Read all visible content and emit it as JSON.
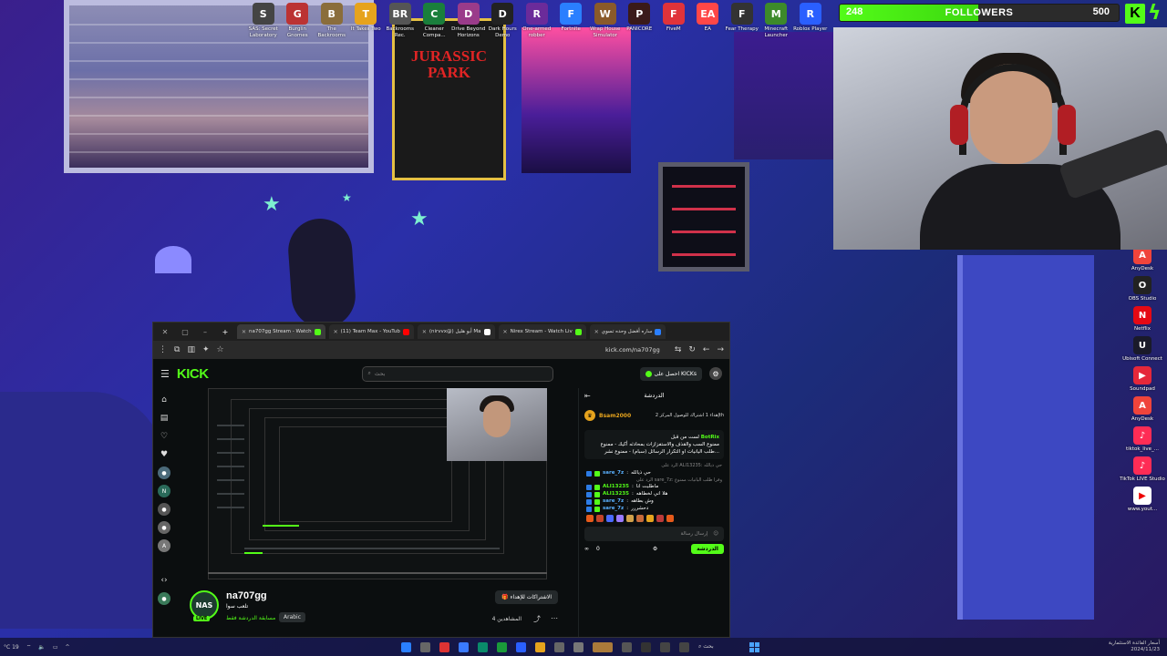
{
  "desktop_top_icons": [
    {
      "label": "SAS: Secret Laboratory",
      "icon": "sas-icon",
      "color": "#444",
      "glyph": "S"
    },
    {
      "label": "Burglin Gnomes",
      "icon": "gnome-icon",
      "color": "#b33",
      "glyph": "G"
    },
    {
      "label": "The Backrooms",
      "icon": "backrooms-icon",
      "color": "#8a6d3b",
      "glyph": "B"
    },
    {
      "label": "It Takes Two",
      "icon": "ittakestwo-icon",
      "color": "#e6a31d",
      "glyph": "T"
    },
    {
      "label": "Backrooms Rec.",
      "icon": "backrooms-rec-icon",
      "color": "#555",
      "glyph": "BR"
    },
    {
      "label": "Cleaner Compa...",
      "icon": "cleaner-icon",
      "color": "#1a7f3c",
      "glyph": "C"
    },
    {
      "label": "Drive Beyond Horizons",
      "icon": "drive-icon",
      "color": "#9a3b8a",
      "glyph": "D"
    },
    {
      "label": "Dark Hours Demo",
      "icon": "darkhours-icon",
      "color": "#222",
      "glyph": "D"
    },
    {
      "label": "One-armed robber",
      "icon": "robber-icon",
      "color": "#6b2b9a",
      "glyph": "R"
    },
    {
      "label": "Fortnite",
      "icon": "fortnite-icon",
      "color": "#2a7fff",
      "glyph": "F"
    },
    {
      "label": "Wrap House Simulator",
      "icon": "wrap-icon",
      "color": "#8a5a2a",
      "glyph": "W"
    },
    {
      "label": "PANICORE",
      "icon": "panicore-icon",
      "color": "#3a1a1a",
      "glyph": "P"
    },
    {
      "label": "FiveM",
      "icon": "fivem-icon",
      "color": "#e0333a",
      "glyph": "F"
    },
    {
      "label": "EA",
      "icon": "ea-icon",
      "color": "#ff4747",
      "glyph": "EA"
    },
    {
      "label": "Fear Therapy",
      "icon": "fear-icon",
      "color": "#333",
      "glyph": "F"
    },
    {
      "label": "Minecraft Launcher",
      "icon": "minecraft-icon",
      "color": "#3d8a2a",
      "glyph": "M"
    },
    {
      "label": "Roblox Player",
      "icon": "roblox-icon",
      "color": "#2a5fff",
      "glyph": "R"
    }
  ],
  "desktop_side_icons": [
    {
      "label": "AnyDesk",
      "icon": "anydesk-icon",
      "color": "#ef443b",
      "glyph": "A"
    },
    {
      "label": "OBS Studio",
      "icon": "obs-icon",
      "color": "#222",
      "glyph": "O"
    },
    {
      "label": "Netflix",
      "icon": "netflix-icon",
      "color": "#e50914",
      "glyph": "N"
    },
    {
      "label": "Ubisoft Connect",
      "icon": "ubisoft-icon",
      "color": "#1a1a2a",
      "glyph": "U"
    },
    {
      "label": "Soundpad",
      "icon": "soundpad-icon",
      "color": "#e5283a",
      "glyph": "▶"
    },
    {
      "label": "AnyDesk",
      "icon": "anydesk-icon",
      "color": "#ef443b",
      "glyph": "A"
    },
    {
      "label": "tiktok_live_...",
      "icon": "tiktok-icon",
      "color": "#fe2c55",
      "glyph": "♪"
    },
    {
      "label": "TikTok LIVE Studio",
      "icon": "tiktok-studio-icon",
      "color": "#fe2c55",
      "glyph": "♪"
    },
    {
      "label": "www.yout...",
      "icon": "youtube-icon",
      "color": "#fff",
      "glyph": "▶"
    }
  ],
  "goal": {
    "current": "248",
    "label": "FOLLOWERS",
    "target": "500",
    "progress": 0.496,
    "accent": "#53fc18"
  },
  "browser": {
    "tabs": [
      {
        "title": "na707gg Stream - Watch",
        "color": "#53fc18",
        "active": true
      },
      {
        "title": "(11) Team Max - YouTub",
        "color": "#ff0000",
        "active": false
      },
      {
        "title": "(nirvvx@) أبو هليل Ma",
        "color": "#ffffff",
        "active": false
      },
      {
        "title": "Nirex Stream - Watch Liv",
        "color": "#53fc18",
        "active": false
      },
      {
        "title": "ساره أفضل وحده تسوي",
        "color": "#2a7fff",
        "active": false
      }
    ],
    "url": "kick.com/na707gg"
  },
  "kick": {
    "logo": "KICK",
    "search_placeholder": "بحث",
    "kicks_button": "احصل على KICKs",
    "channel": {
      "name": "na707gg",
      "avatar_text": "NAS",
      "live_label": "LIVE",
      "game": "تلعب سوا",
      "category": "مسابقة الدردشة فقط",
      "language": "Arabic",
      "subscribe_label": "الاشتراكات للإهداء",
      "viewers": "4 المشاهدين"
    },
    "chat": {
      "title": "الدردشة",
      "pinned_user": "Bsam2000",
      "pinned_user_msg": "إهداء 1 اشتراك للوصول المركز 2th",
      "pinned_bot": "BotRix",
      "pinned_bot_prefix": "لست من قبل",
      "pinned_text": "ممنوع السب والقذف والاستفزازات بمحادثه أكيك - ممنوع طلب اليانيات او التكرار الرسائل (سبام) - ممنوع نشر...",
      "messages": [
        {
          "reply": "الرد على ALI13235: حي ذيالله",
          "user": "sare_7z",
          "text": "حي ذيالله",
          "color": "u2"
        },
        {
          "reply": "الرد على sare_7z: وفرا طلب اليانيات ممنوع",
          "user": "ALI13235",
          "text": "ماطلبت انا",
          "color": "u1"
        },
        {
          "reply": "",
          "user": "ALI13235",
          "text": "هلا اني لخطاهه",
          "color": "u1"
        },
        {
          "reply": "",
          "user": "sare_7z",
          "text": "وش بطاهه",
          "color": "u2"
        },
        {
          "reply": "",
          "user": "sare_7z",
          "text": "دحشررر",
          "color": "u2"
        }
      ],
      "input_placeholder": "إرسال رسالة",
      "points": "0",
      "send_label": "الدردشة"
    }
  },
  "taskbar": {
    "weather": "°C 19",
    "search_label": "بحث",
    "clock_line1": "أسعار الفائدة الاستئمارية",
    "clock_line2": "2024/11/23"
  }
}
